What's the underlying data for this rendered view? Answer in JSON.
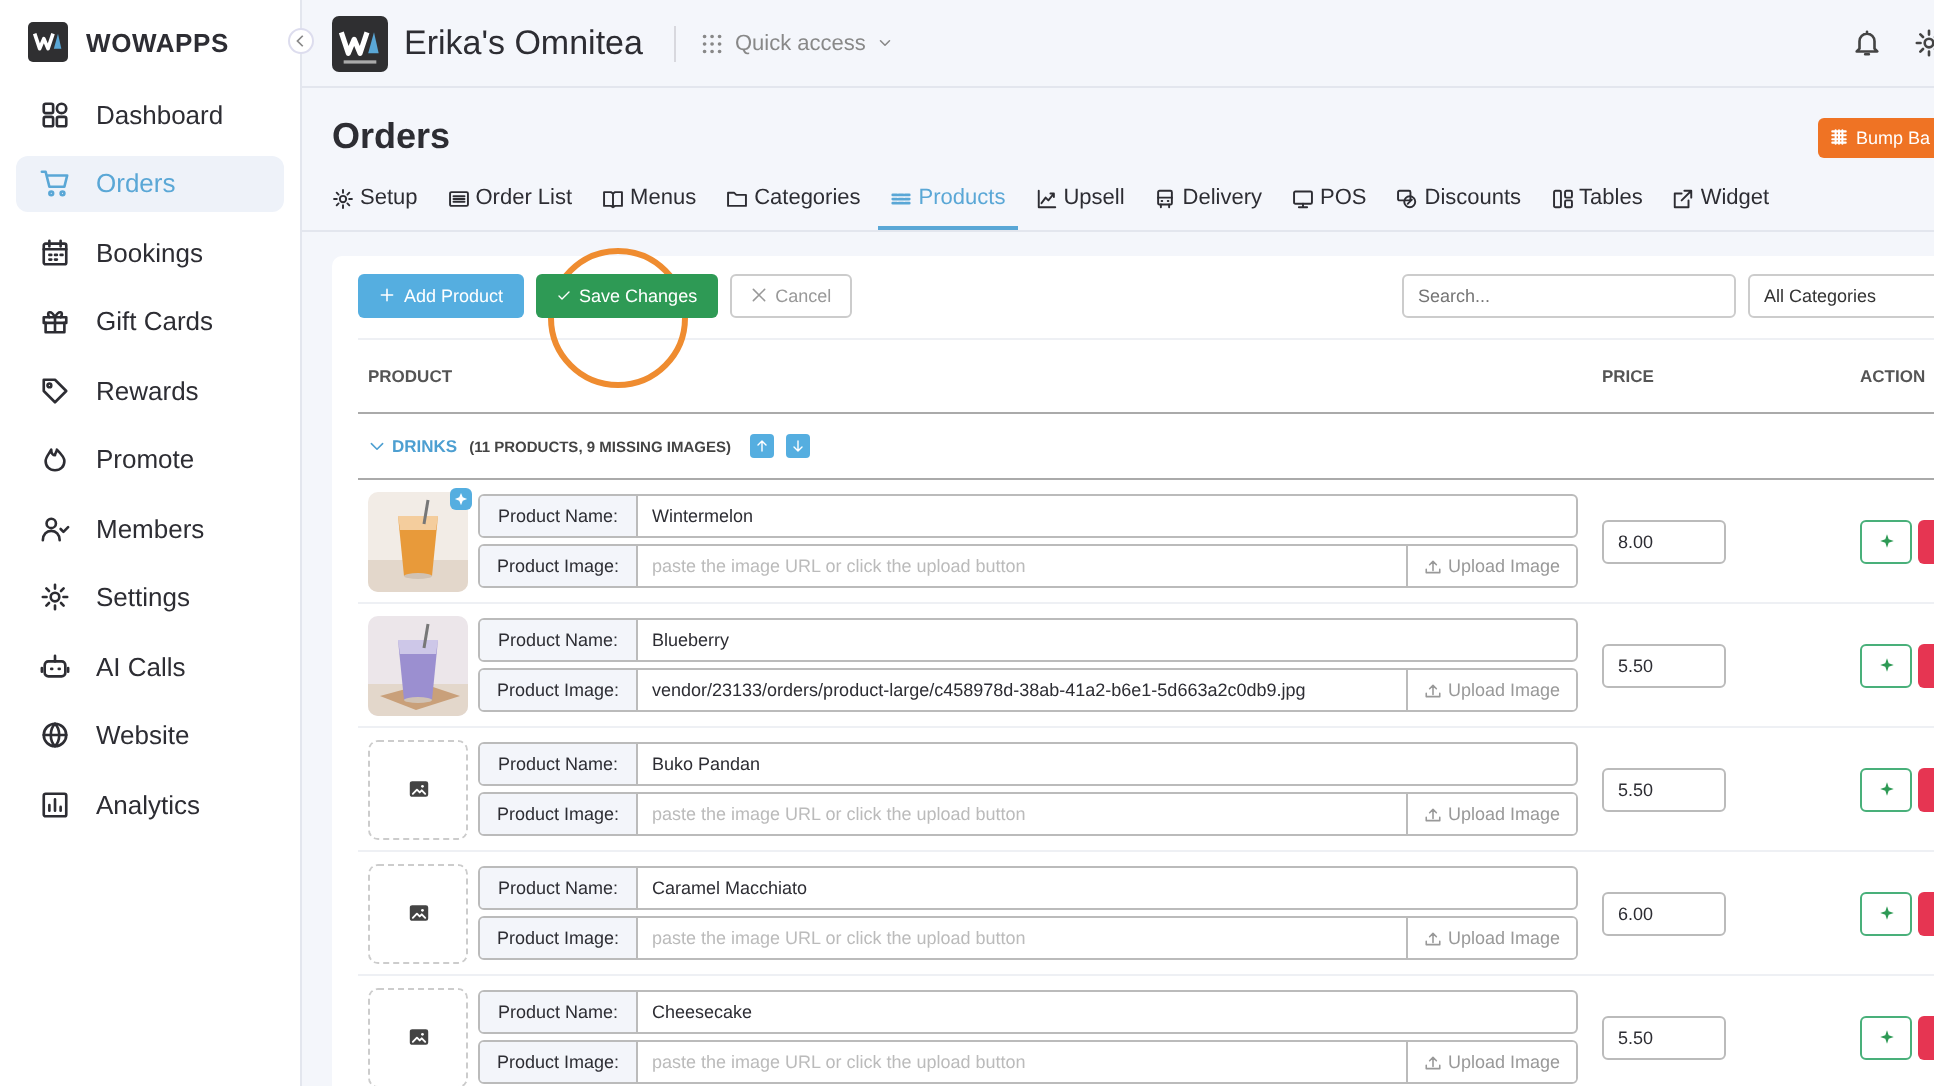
{
  "sidebar": {
    "brand": "WOWAPPS",
    "items": [
      {
        "label": "Dashboard",
        "selected": false
      },
      {
        "label": "Orders",
        "selected": true
      },
      {
        "label": "Bookings",
        "selected": false
      },
      {
        "label": "Gift Cards",
        "selected": false
      },
      {
        "label": "Rewards",
        "selected": false
      },
      {
        "label": "Promote",
        "selected": false
      },
      {
        "label": "Members",
        "selected": false
      },
      {
        "label": "Settings",
        "selected": false
      },
      {
        "label": "AI Calls",
        "selected": false
      },
      {
        "label": "Website",
        "selected": false
      },
      {
        "label": "Analytics",
        "selected": false
      }
    ]
  },
  "header": {
    "title": "Erika's Omnitea",
    "quick_access": "Quick access"
  },
  "page": {
    "title": "Orders",
    "bump_button": "Bump Ba"
  },
  "tabs": [
    {
      "label": "Setup",
      "selected": false
    },
    {
      "label": "Order List",
      "selected": false
    },
    {
      "label": "Menus",
      "selected": false
    },
    {
      "label": "Categories",
      "selected": false
    },
    {
      "label": "Products",
      "selected": true
    },
    {
      "label": "Upsell",
      "selected": false
    },
    {
      "label": "Delivery",
      "selected": false
    },
    {
      "label": "POS",
      "selected": false
    },
    {
      "label": "Discounts",
      "selected": false
    },
    {
      "label": "Tables",
      "selected": false
    },
    {
      "label": "Widget",
      "selected": false
    }
  ],
  "toolbar": {
    "add": "Add Product",
    "save": "Save Changes",
    "cancel": "Cancel",
    "search_placeholder": "Search...",
    "category": "All Categories"
  },
  "table": {
    "columns": [
      "PRODUCT",
      "PRICE",
      "ACTION"
    ],
    "group": {
      "name": "DRINKS",
      "summary": "(11 PRODUCTS, 9 MISSING IMAGES)",
      "expanded": true
    },
    "rows": [
      {
        "badge": true,
        "name_label": "Product Name:",
        "name": "Wintermelon",
        "image_label": "Product Image:",
        "placeholder": "paste the image URL or click the upload button",
        "upload": "Upload Image",
        "price": "8.00"
      },
      {
        "badge": false,
        "name_label": "Product Name:",
        "name": "Blueberry",
        "image_label": "Product Image:",
        "image_url": "vendor/23133/orders/product-large/c458978d-38ab-41a2-b6e1-5d663a2c0db9.jpg",
        "upload": "Upload Image",
        "price": "5.50"
      },
      {
        "kind": "empty",
        "badge": false,
        "name_label": "Product Name:",
        "name": "Buko Pandan",
        "image_label": "Product Image:",
        "placeholder": "paste the image URL or click the upload button",
        "upload": "Upload Image",
        "price": "5.50"
      },
      {
        "kind": "empty",
        "badge": false,
        "name_label": "Product Name:",
        "name": "Caramel Macchiato",
        "image_label": "Product Image:",
        "placeholder": "paste the image URL or click the upload button",
        "upload": "Upload Image",
        "price": "6.00"
      },
      {
        "kind": "empty",
        "badge": false,
        "name_label": "Product Name:",
        "name": "Cheesecake",
        "image_label": "Product Image:",
        "placeholder": "paste the image URL or click the upload button",
        "upload": "Upload Image",
        "price": "5.50"
      }
    ]
  }
}
